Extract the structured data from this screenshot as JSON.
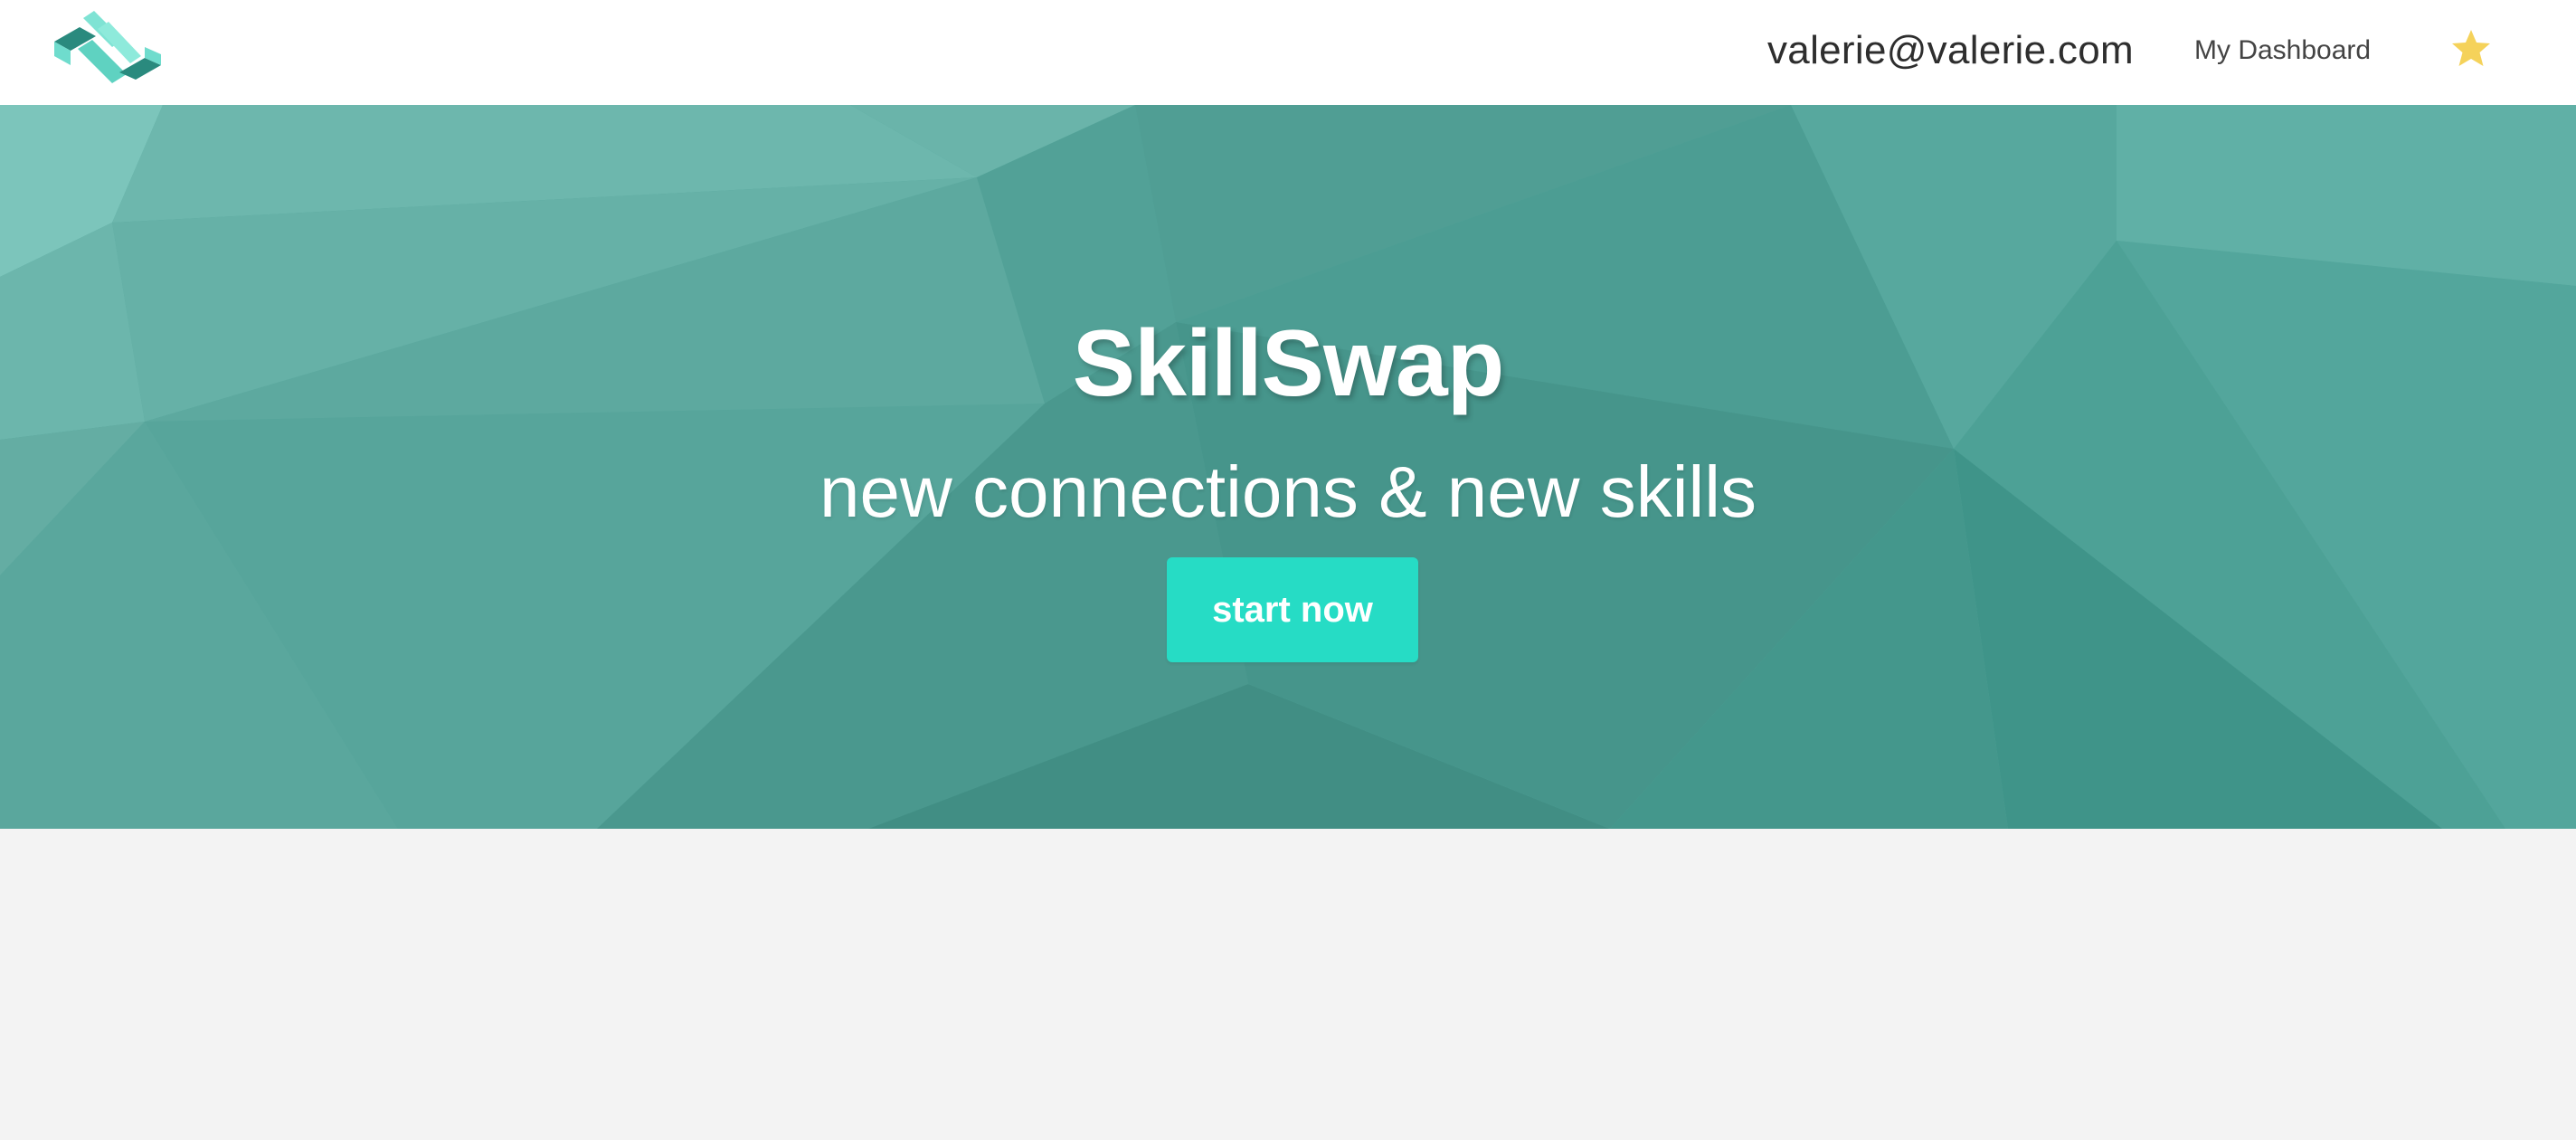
{
  "navbar": {
    "logo_icon": "skillswap-logo-icon",
    "user_email": "valerie@valerie.com",
    "dashboard_label": "My Dashboard",
    "star_icon": "star-icon",
    "star_color": "#f5d25a"
  },
  "hero": {
    "title": "SkillSwap",
    "subtitle": "new connections & new skills",
    "cta_label": "start now",
    "background_color": "#55a79d",
    "button_color": "#26dcc5"
  },
  "colors": {
    "nav_background": "#ffffff",
    "page_background": "#f3f3f3",
    "logo_light": "#6fdccd",
    "logo_dark": "#2a8a7e"
  }
}
